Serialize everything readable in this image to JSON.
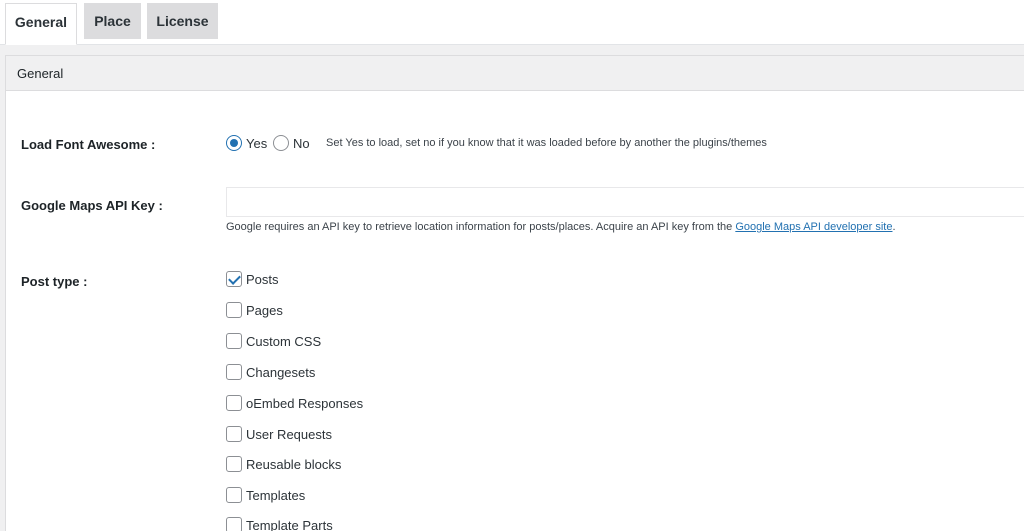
{
  "tabs": [
    {
      "label": "General",
      "active": true
    },
    {
      "label": "Place",
      "active": false
    },
    {
      "label": "License",
      "active": false
    }
  ],
  "section": {
    "title": "General"
  },
  "load_font_awesome": {
    "label": "Load Font Awesome :",
    "options": [
      {
        "label": "Yes",
        "checked": true
      },
      {
        "label": "No",
        "checked": false
      }
    ],
    "help": "Set Yes to load, set no if you know that it was loaded before by another the plugins/themes"
  },
  "google_maps_api_key": {
    "label": "Google Maps API Key :",
    "value": "",
    "help_text": "Google requires an API key to retrieve location information for posts/places. Acquire an API key from the ",
    "help_link": "Google Maps API developer site",
    "help_end": "."
  },
  "post_type": {
    "label": "Post type :",
    "options": [
      {
        "label": "Posts",
        "checked": true
      },
      {
        "label": "Pages",
        "checked": false
      },
      {
        "label": "Custom CSS",
        "checked": false
      },
      {
        "label": "Changesets",
        "checked": false
      },
      {
        "label": "oEmbed Responses",
        "checked": false
      },
      {
        "label": "User Requests",
        "checked": false
      },
      {
        "label": "Reusable blocks",
        "checked": false
      },
      {
        "label": "Templates",
        "checked": false
      },
      {
        "label": "Template Parts",
        "checked": false
      }
    ]
  },
  "colors": {
    "accent": "#2271b1",
    "header_bg": "#f0f0f1",
    "tab_inactive_bg": "#dcdcde"
  }
}
